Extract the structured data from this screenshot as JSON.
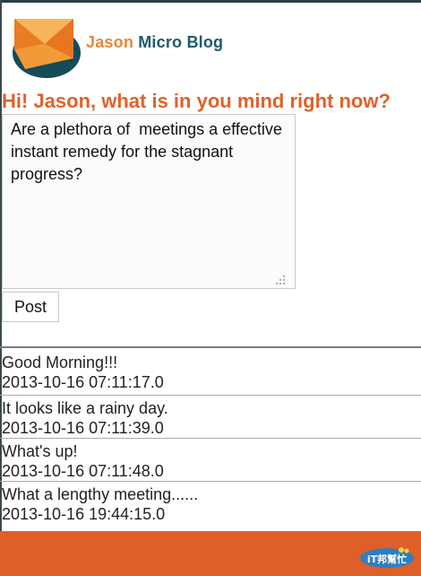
{
  "header": {
    "brand_first": "Jason",
    "brand_second": "Micro Blog",
    "logo_icon": "envelope-logo-icon"
  },
  "composer": {
    "prompt": "Hi! Jason, what is in you mind right now?",
    "value": "Are a plethora of  meetings a effective instant remedy for the stagnant progress?",
    "post_label": "Post"
  },
  "feed": {
    "posts": [
      {
        "text": "Good Morning!!!",
        "time": "2013-10-16 07:11:17.0"
      },
      {
        "text": "It looks like a rainy day.",
        "time": "2013-10-16 07:11:39.0"
      },
      {
        "text": "What's up!",
        "time": "2013-10-16 07:11:48.0"
      },
      {
        "text": "What a lengthy meeting......",
        "time": "2013-10-16 19:44:15.0"
      }
    ]
  },
  "footer": {
    "badge_text": "iT邦幫忙",
    "badge_icon": "ithelp-badge-icon"
  },
  "colors": {
    "accent_orange": "#e0622a",
    "footer_orange": "#de5f27",
    "brand_teal": "#1d5a6a",
    "logo_orange": "#f28a2e"
  }
}
